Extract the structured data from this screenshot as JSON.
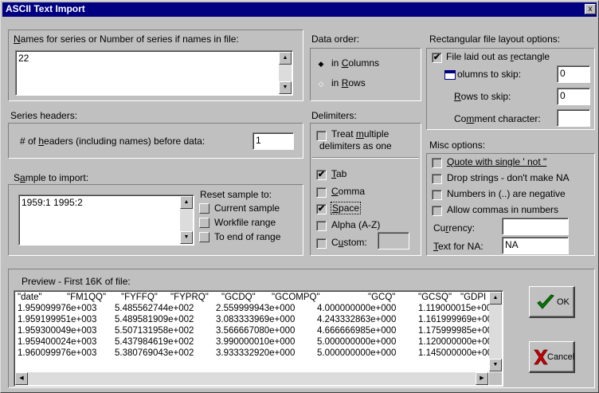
{
  "window": {
    "title": "ASCII Text Import",
    "close_glyph": "x"
  },
  "names_section": {
    "label": "Names for series or Number of series if names in file:",
    "value": "22"
  },
  "headers_section": {
    "title": "Series headers:",
    "label": "# of headers (including names) before data:",
    "value": "1"
  },
  "sample_section": {
    "label": "Sample to import:",
    "value": "1959:1 1995:2",
    "reset_label": "Reset sample to:",
    "buttons": [
      "Current sample",
      "Workfile range",
      "To end of range"
    ]
  },
  "data_order": {
    "label": "Data order:",
    "options": [
      {
        "label": "in Columns",
        "selected": true
      },
      {
        "label": "in Rows",
        "selected": false
      }
    ]
  },
  "delimiters": {
    "label": "Delimiters:",
    "treat_multiple": {
      "line1": "Treat multiple",
      "line2": "delimiters as one",
      "checked": false
    },
    "options": [
      {
        "label": "Tab",
        "checked": true
      },
      {
        "label": "Comma",
        "checked": false
      },
      {
        "label": "Space",
        "checked": true
      },
      {
        "label": "Alpha (A-Z)",
        "checked": false
      },
      {
        "label": "Custom:",
        "checked": false
      }
    ],
    "custom_value": ""
  },
  "rect_layout": {
    "label": "Rectangular file layout options:",
    "file_rect": {
      "label": "File laid out as rectangle",
      "checked": true
    },
    "columns_to_skip": {
      "label": "olumns to skip:",
      "value": "0"
    },
    "rows_to_skip": {
      "label": "Rows to skip:",
      "value": "0"
    },
    "comment_char": {
      "label": "Comment character:",
      "value": ""
    }
  },
  "misc": {
    "label": "Misc options:",
    "options": [
      {
        "label": "Quote with single ' not \"",
        "checked": false
      },
      {
        "label": "Drop strings - don't make NA",
        "checked": false
      },
      {
        "label": "Numbers in (..) are negative",
        "checked": false
      },
      {
        "label": "Allow commas in numbers",
        "checked": false
      }
    ],
    "currency": {
      "label": "Currency:",
      "value": ""
    },
    "text_for_na": {
      "label": "Text for NA:",
      "value": "NA"
    }
  },
  "preview": {
    "label": "Preview - First 16K of file:",
    "header": [
      "\"date\"",
      "\"FM1QQ\"",
      "\"FYFFQ\"",
      "\"FYPRQ\"",
      "\"GCDQ\"",
      "\"GCOMPQ\"",
      "\"GCQ\"",
      "\"GCSQ\"",
      "\"GDPI"
    ],
    "rows": [
      [
        "1.959099976e+003",
        "5.485562744e+002",
        "2.559999943e+000",
        "4.000000000e+000",
        "1.119000015e+00"
      ],
      [
        "1.959199951e+003",
        "5.489581909e+002",
        "3.083333969e+000",
        "4.243332863e+000",
        "1.161999969e+00"
      ],
      [
        "1.959300049e+003",
        "5.507131958e+002",
        "3.566667080e+000",
        "4.666666985e+000",
        "1.175999985e+00"
      ],
      [
        "1.959400024e+003",
        "5.437984619e+002",
        "3.990000010e+000",
        "5.000000000e+000",
        "1.120000000e+00"
      ],
      [
        "1.960099976e+003",
        "5.380769043e+002",
        "3.933332920e+000",
        "5.000000000e+000",
        "1.145000000e+00"
      ]
    ]
  },
  "buttons": {
    "ok": "OK",
    "cancel": "Cancel"
  },
  "colors": {
    "title_bg": "#000080",
    "dialog_bg": "#c0c0c0",
    "ok_check": "#008000",
    "cancel_x": "#cc0000"
  }
}
